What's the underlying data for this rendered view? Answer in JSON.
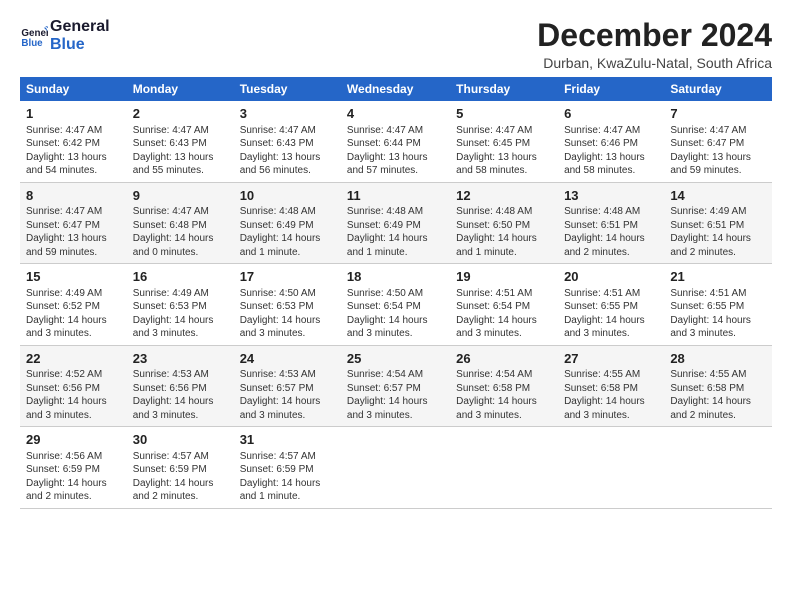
{
  "logo": {
    "line1": "General",
    "line2": "Blue"
  },
  "title": "December 2024",
  "subtitle": "Durban, KwaZulu-Natal, South Africa",
  "days_of_week": [
    "Sunday",
    "Monday",
    "Tuesday",
    "Wednesday",
    "Thursday",
    "Friday",
    "Saturday"
  ],
  "weeks": [
    [
      {
        "day": "1",
        "info": "Sunrise: 4:47 AM\nSunset: 6:42 PM\nDaylight: 13 hours\nand 54 minutes."
      },
      {
        "day": "2",
        "info": "Sunrise: 4:47 AM\nSunset: 6:43 PM\nDaylight: 13 hours\nand 55 minutes."
      },
      {
        "day": "3",
        "info": "Sunrise: 4:47 AM\nSunset: 6:43 PM\nDaylight: 13 hours\nand 56 minutes."
      },
      {
        "day": "4",
        "info": "Sunrise: 4:47 AM\nSunset: 6:44 PM\nDaylight: 13 hours\nand 57 minutes."
      },
      {
        "day": "5",
        "info": "Sunrise: 4:47 AM\nSunset: 6:45 PM\nDaylight: 13 hours\nand 58 minutes."
      },
      {
        "day": "6",
        "info": "Sunrise: 4:47 AM\nSunset: 6:46 PM\nDaylight: 13 hours\nand 58 minutes."
      },
      {
        "day": "7",
        "info": "Sunrise: 4:47 AM\nSunset: 6:47 PM\nDaylight: 13 hours\nand 59 minutes."
      }
    ],
    [
      {
        "day": "8",
        "info": "Sunrise: 4:47 AM\nSunset: 6:47 PM\nDaylight: 13 hours\nand 59 minutes."
      },
      {
        "day": "9",
        "info": "Sunrise: 4:47 AM\nSunset: 6:48 PM\nDaylight: 14 hours\nand 0 minutes."
      },
      {
        "day": "10",
        "info": "Sunrise: 4:48 AM\nSunset: 6:49 PM\nDaylight: 14 hours\nand 1 minute."
      },
      {
        "day": "11",
        "info": "Sunrise: 4:48 AM\nSunset: 6:49 PM\nDaylight: 14 hours\nand 1 minute."
      },
      {
        "day": "12",
        "info": "Sunrise: 4:48 AM\nSunset: 6:50 PM\nDaylight: 14 hours\nand 1 minute."
      },
      {
        "day": "13",
        "info": "Sunrise: 4:48 AM\nSunset: 6:51 PM\nDaylight: 14 hours\nand 2 minutes."
      },
      {
        "day": "14",
        "info": "Sunrise: 4:49 AM\nSunset: 6:51 PM\nDaylight: 14 hours\nand 2 minutes."
      }
    ],
    [
      {
        "day": "15",
        "info": "Sunrise: 4:49 AM\nSunset: 6:52 PM\nDaylight: 14 hours\nand 3 minutes."
      },
      {
        "day": "16",
        "info": "Sunrise: 4:49 AM\nSunset: 6:53 PM\nDaylight: 14 hours\nand 3 minutes."
      },
      {
        "day": "17",
        "info": "Sunrise: 4:50 AM\nSunset: 6:53 PM\nDaylight: 14 hours\nand 3 minutes."
      },
      {
        "day": "18",
        "info": "Sunrise: 4:50 AM\nSunset: 6:54 PM\nDaylight: 14 hours\nand 3 minutes."
      },
      {
        "day": "19",
        "info": "Sunrise: 4:51 AM\nSunset: 6:54 PM\nDaylight: 14 hours\nand 3 minutes."
      },
      {
        "day": "20",
        "info": "Sunrise: 4:51 AM\nSunset: 6:55 PM\nDaylight: 14 hours\nand 3 minutes."
      },
      {
        "day": "21",
        "info": "Sunrise: 4:51 AM\nSunset: 6:55 PM\nDaylight: 14 hours\nand 3 minutes."
      }
    ],
    [
      {
        "day": "22",
        "info": "Sunrise: 4:52 AM\nSunset: 6:56 PM\nDaylight: 14 hours\nand 3 minutes."
      },
      {
        "day": "23",
        "info": "Sunrise: 4:53 AM\nSunset: 6:56 PM\nDaylight: 14 hours\nand 3 minutes."
      },
      {
        "day": "24",
        "info": "Sunrise: 4:53 AM\nSunset: 6:57 PM\nDaylight: 14 hours\nand 3 minutes."
      },
      {
        "day": "25",
        "info": "Sunrise: 4:54 AM\nSunset: 6:57 PM\nDaylight: 14 hours\nand 3 minutes."
      },
      {
        "day": "26",
        "info": "Sunrise: 4:54 AM\nSunset: 6:58 PM\nDaylight: 14 hours\nand 3 minutes."
      },
      {
        "day": "27",
        "info": "Sunrise: 4:55 AM\nSunset: 6:58 PM\nDaylight: 14 hours\nand 3 minutes."
      },
      {
        "day": "28",
        "info": "Sunrise: 4:55 AM\nSunset: 6:58 PM\nDaylight: 14 hours\nand 2 minutes."
      }
    ],
    [
      {
        "day": "29",
        "info": "Sunrise: 4:56 AM\nSunset: 6:59 PM\nDaylight: 14 hours\nand 2 minutes."
      },
      {
        "day": "30",
        "info": "Sunrise: 4:57 AM\nSunset: 6:59 PM\nDaylight: 14 hours\nand 2 minutes."
      },
      {
        "day": "31",
        "info": "Sunrise: 4:57 AM\nSunset: 6:59 PM\nDaylight: 14 hours\nand 1 minute."
      },
      {
        "day": "",
        "info": ""
      },
      {
        "day": "",
        "info": ""
      },
      {
        "day": "",
        "info": ""
      },
      {
        "day": "",
        "info": ""
      }
    ]
  ]
}
